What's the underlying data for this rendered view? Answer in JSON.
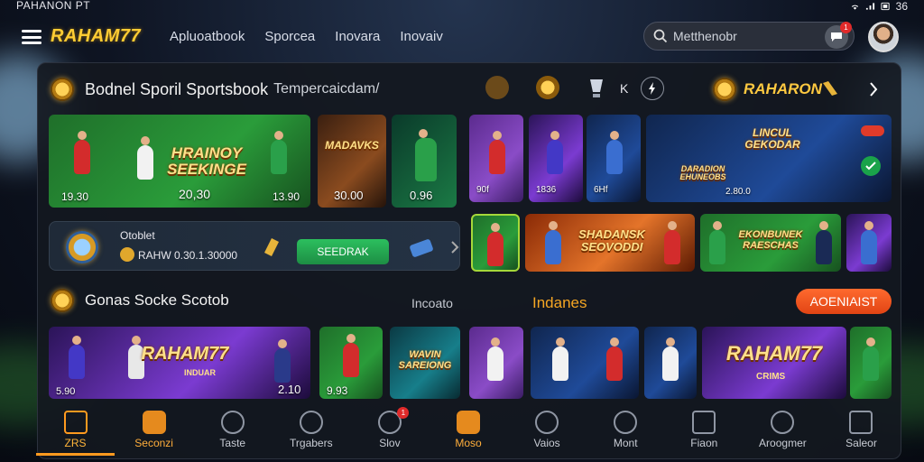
{
  "status_bar": {
    "time": "PAHANON PT",
    "clock": "36"
  },
  "brand": "RAHAM77",
  "nav": [
    "Apluoatbook",
    "Sporcea",
    "Inovara",
    "Inovaiv"
  ],
  "search": {
    "value": "Metthenobr",
    "chat_badge": "1"
  },
  "section1": {
    "title": "Bodnel Sporil Sportsbook",
    "subtitle": "Tempercaicdam/",
    "right_brand": "RAHARON",
    "mini_x": "K"
  },
  "cards_row1": [
    {
      "big": "HRAINOY\nSEEKINGE",
      "left": "19.30",
      "mid": "20,30",
      "right": "13.90"
    },
    {
      "big": "MADAVKS",
      "value": "30.00"
    },
    {
      "value": "0.96"
    },
    {
      "value": "90f"
    },
    {
      "value": "1836"
    },
    {
      "value": "6Hf"
    },
    {
      "big": "LINCUL\nGEKODAR",
      "sub": "DARADION\nEHUNEOBS",
      "value": "2.80.0"
    }
  ],
  "promo": {
    "title": "Otoblet",
    "odds": "RAHW 0.30.1.30000",
    "button": "SEEDRAK"
  },
  "cards_row2": [
    {
      "big": "SHADANSK\nSEOVODDI"
    },
    {
      "big": "EKONBUNEK\nRAESCHAS"
    }
  ],
  "section2": {
    "title": "Gonas Socke Scotob",
    "mid": "Incoato",
    "right": "Indanes",
    "button": "AOENIAIST"
  },
  "cards_row3": [
    {
      "big": "RAHAM77",
      "tag": "INDUAR",
      "left": "5.90",
      "right": "2.10"
    },
    {
      "value": "9.93"
    },
    {
      "big": "WAVIN\nSAREIONG"
    },
    {
      "big": "RAHAM77",
      "tag": "CRIMS"
    }
  ],
  "bottom_nav": [
    {
      "label": "ZRS",
      "icon": "home-icon",
      "state": "active"
    },
    {
      "label": "Seconzi",
      "icon": "hand-icon",
      "state": "accent"
    },
    {
      "label": "Taste",
      "icon": "info-icon",
      "state": ""
    },
    {
      "label": "Trgabers",
      "icon": "ball-icon",
      "state": ""
    },
    {
      "label": "Slov",
      "icon": "bell-icon",
      "state": "",
      "badge": "1"
    },
    {
      "label": "Moso",
      "icon": "shield-icon",
      "state": "accent"
    },
    {
      "label": "Vaios",
      "icon": "compass-icon",
      "state": ""
    },
    {
      "label": "Mont",
      "icon": "target-icon",
      "state": ""
    },
    {
      "label": "Fiaon",
      "icon": "r-icon",
      "state": ""
    },
    {
      "label": "Aroogmer",
      "icon": "bolt-icon",
      "state": ""
    },
    {
      "label": "Saleor",
      "icon": "list-icon",
      "state": ""
    }
  ]
}
